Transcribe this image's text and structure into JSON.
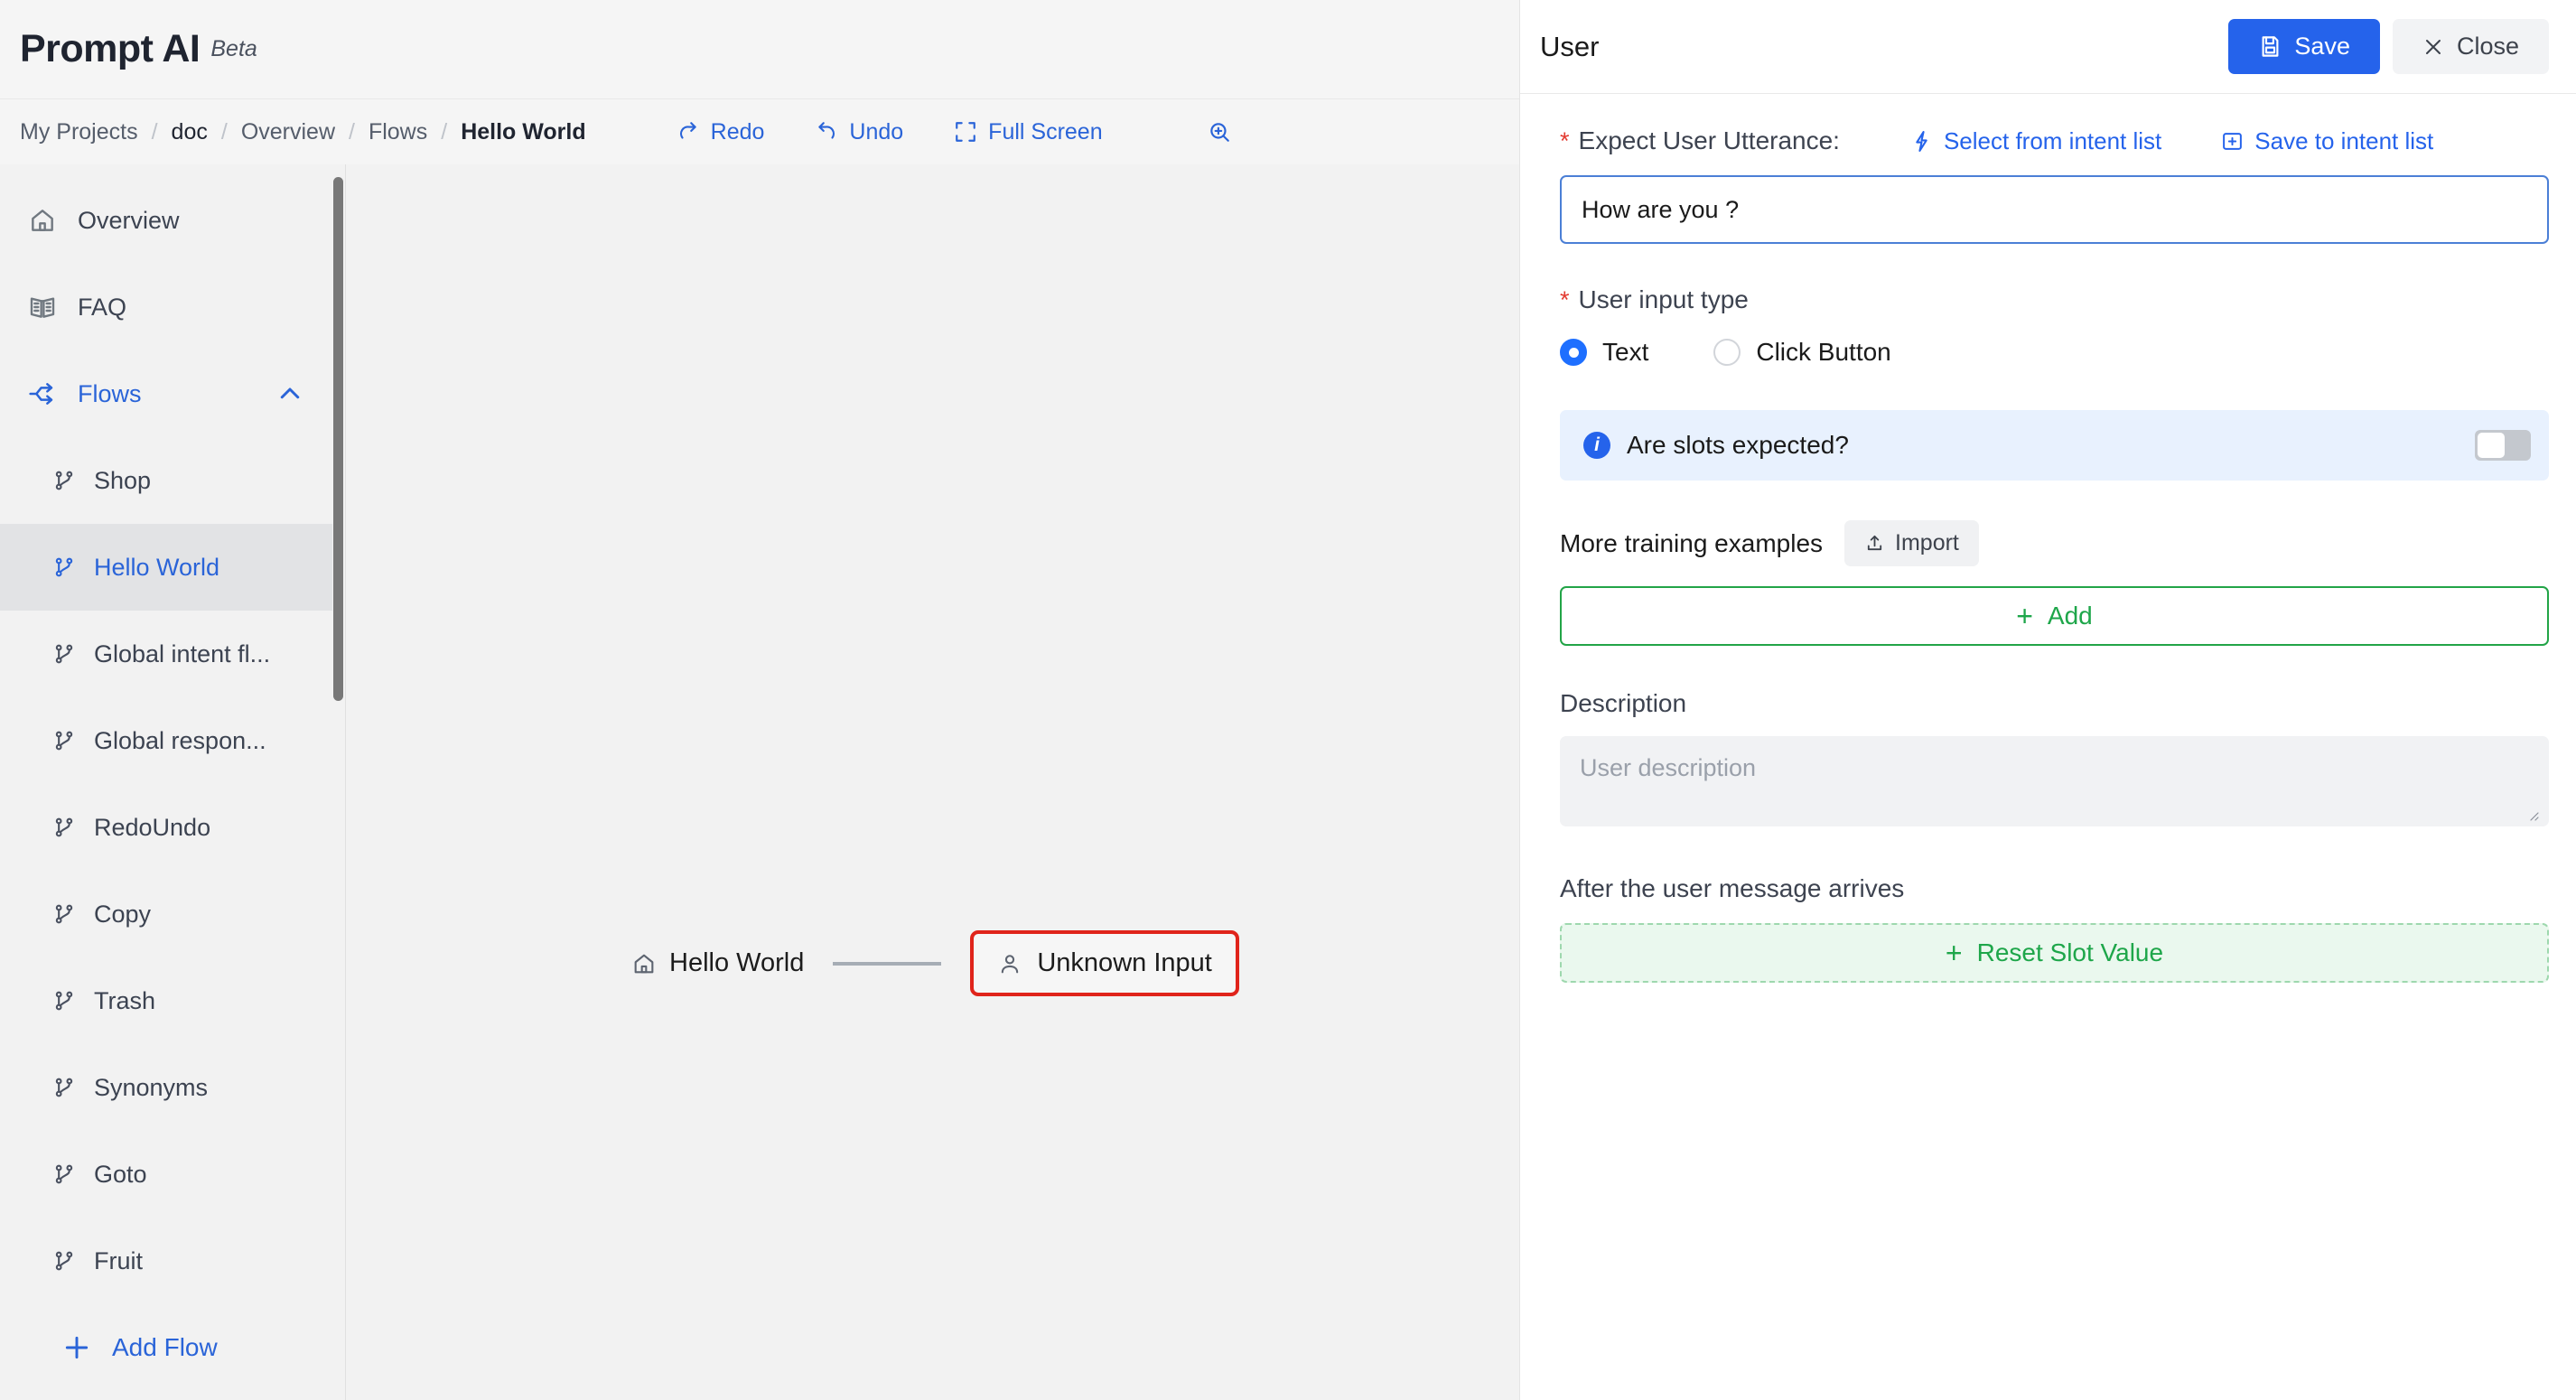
{
  "app": {
    "title": "Prompt AI",
    "badge": "Beta"
  },
  "breadcrumb": {
    "separator": "/",
    "items": [
      {
        "label": "My Projects"
      },
      {
        "label": "doc"
      },
      {
        "label": "Overview"
      },
      {
        "label": "Flows"
      },
      {
        "label": "Hello World"
      }
    ]
  },
  "toolbar": {
    "redo_label": "Redo",
    "undo_label": "Undo",
    "fullscreen_label": "Full Screen"
  },
  "sidebar": {
    "items": [
      {
        "label": "Overview",
        "icon": "home-icon"
      },
      {
        "label": "FAQ",
        "icon": "book-icon"
      },
      {
        "label": "Flows",
        "icon": "flows-icon"
      }
    ],
    "flows": [
      {
        "label": "Shop"
      },
      {
        "label": "Hello World"
      },
      {
        "label": "Global intent fl..."
      },
      {
        "label": "Global respon..."
      },
      {
        "label": "RedoUndo"
      },
      {
        "label": "Copy"
      },
      {
        "label": "Trash"
      },
      {
        "label": "Synonyms"
      },
      {
        "label": "Goto"
      },
      {
        "label": "Fruit"
      }
    ],
    "add_flow_label": "Add Flow"
  },
  "canvas": {
    "start_node": "Hello World",
    "user_node": "Unknown Input"
  },
  "panel": {
    "title": "User",
    "save_label": "Save",
    "close_label": "Close",
    "utterance": {
      "label": "Expect User Utterance:",
      "required_mark": "*",
      "select_link": "Select from intent list",
      "save_link": "Save to intent list",
      "value": "How are you ?"
    },
    "input_type": {
      "label": "User input type",
      "required_mark": "*",
      "options": [
        {
          "label": "Text",
          "selected": true
        },
        {
          "label": "Click Button",
          "selected": false
        }
      ]
    },
    "slots": {
      "text": "Are slots expected?",
      "toggle_state": "off"
    },
    "training": {
      "label": "More training examples",
      "import_label": "Import",
      "add_label": "Add",
      "plus": "+"
    },
    "description": {
      "label": "Description",
      "placeholder": "User description",
      "value": ""
    },
    "after": {
      "label": "After the user message arrives",
      "reset_label": "Reset Slot Value",
      "plus": "+"
    }
  },
  "colors": {
    "accent_blue": "#2563eb",
    "green": "#1ea64a",
    "red": "#e0241b",
    "info_bg": "#e8f1fe"
  }
}
